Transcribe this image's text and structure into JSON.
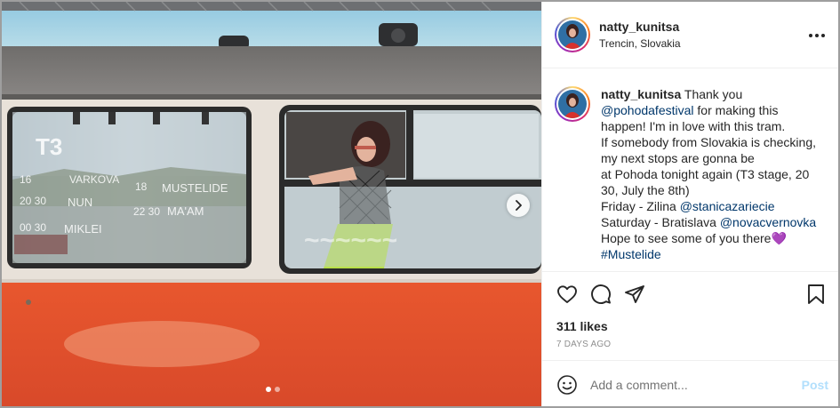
{
  "post": {
    "username": "natty_kunitsa",
    "location": "Trencin, Slovakia",
    "caption_lines": [
      {
        "text": " Thank you"
      },
      {
        "pre": "",
        "mention": "@pohodafestival",
        "post": " for making this"
      },
      {
        "text": "happen! I'm in love with this tram."
      },
      {
        "text": "If somebody from Slovakia is checking,"
      },
      {
        "text": "my next stops are gonna be"
      },
      {
        "text": "at Pohoda tonight again (T3 stage, 20"
      },
      {
        "text": "30, July the 8th)"
      },
      {
        "pre": "Friday - Zilina ",
        "mention": "@stanicazariecie",
        "post": ""
      },
      {
        "pre": "Saturday - Bratislava ",
        "mention": "@novacvernovka",
        "post": ""
      },
      {
        "text": "Hope to see some of you there💜"
      },
      {
        "hashtag": "#Mustelide"
      }
    ],
    "likes": "311 likes",
    "date": "7 DAYS AGO"
  },
  "comment": {
    "placeholder": "Add a comment...",
    "post_label": "Post"
  },
  "carousel": {
    "slide_count": 2,
    "active_slide": 1
  },
  "photo_text": {
    "sign_title": "T3",
    "times": [
      "16",
      "20 30",
      "00 30"
    ],
    "acts": [
      "VARKOVA",
      "NUN",
      "MIKLEI"
    ],
    "times2": [
      "18",
      "22 30"
    ],
    "acts2": [
      "MUSTELIDE",
      "MA'AM"
    ]
  },
  "colors": {
    "link": "#00376b",
    "tram_red": "#e0522f",
    "tram_cream": "#e8e1d9",
    "post_disabled": "#b2dffc"
  },
  "icons": {
    "more": "more-options-icon",
    "like": "heart-icon",
    "comment": "comment-icon",
    "share": "paper-plane-icon",
    "save": "bookmark-icon",
    "emoji": "emoji-icon",
    "next": "chevron-right-icon"
  }
}
